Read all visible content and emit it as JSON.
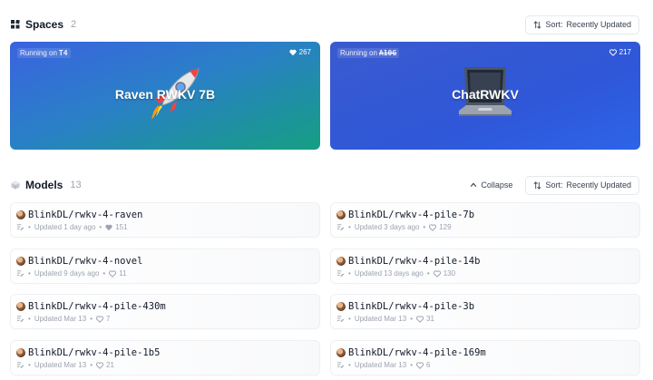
{
  "spaces": {
    "title": "Spaces",
    "count": "2",
    "sort_prefix": "Sort:",
    "sort_value": "Recently Updated",
    "cards": [
      {
        "running_label": "Running on",
        "hardware": "T4",
        "hardware_struck": false,
        "likes": "267",
        "title": "Raven RWKV 7B",
        "emoji": "rocket"
      },
      {
        "running_label": "Running on",
        "hardware": "A10G",
        "hardware_struck": true,
        "likes": "217",
        "title": "ChatRWKV",
        "emoji": "laptop"
      }
    ]
  },
  "models": {
    "title": "Models",
    "count": "13",
    "collapse_label": "Collapse",
    "sort_prefix": "Sort:",
    "sort_value": "Recently Updated",
    "items": [
      {
        "name": "BlinkDL/rwkv-4-raven",
        "updated": "Updated 1 day ago",
        "likes": "151"
      },
      {
        "name": "BlinkDL/rwkv-4-pile-7b",
        "updated": "Updated 3 days ago",
        "likes": "129"
      },
      {
        "name": "BlinkDL/rwkv-4-novel",
        "updated": "Updated 9 days ago",
        "likes": "11"
      },
      {
        "name": "BlinkDL/rwkv-4-pile-14b",
        "updated": "Updated 13 days ago",
        "likes": "130"
      },
      {
        "name": "BlinkDL/rwkv-4-pile-430m",
        "updated": "Updated Mar 13",
        "likes": "7"
      },
      {
        "name": "BlinkDL/rwkv-4-pile-3b",
        "updated": "Updated Mar 13",
        "likes": "31"
      },
      {
        "name": "BlinkDL/rwkv-4-pile-1b5",
        "updated": "Updated Mar 13",
        "likes": "21"
      },
      {
        "name": "BlinkDL/rwkv-4-pile-169m",
        "updated": "Updated Mar 13",
        "likes": "6"
      }
    ]
  },
  "colors": {
    "raven_gradient": [
      "#3b63e0",
      "#159f82"
    ],
    "chat_gradient": [
      "#3b5bcf",
      "#2d64e8"
    ],
    "muted_text": "#9ca3af"
  }
}
